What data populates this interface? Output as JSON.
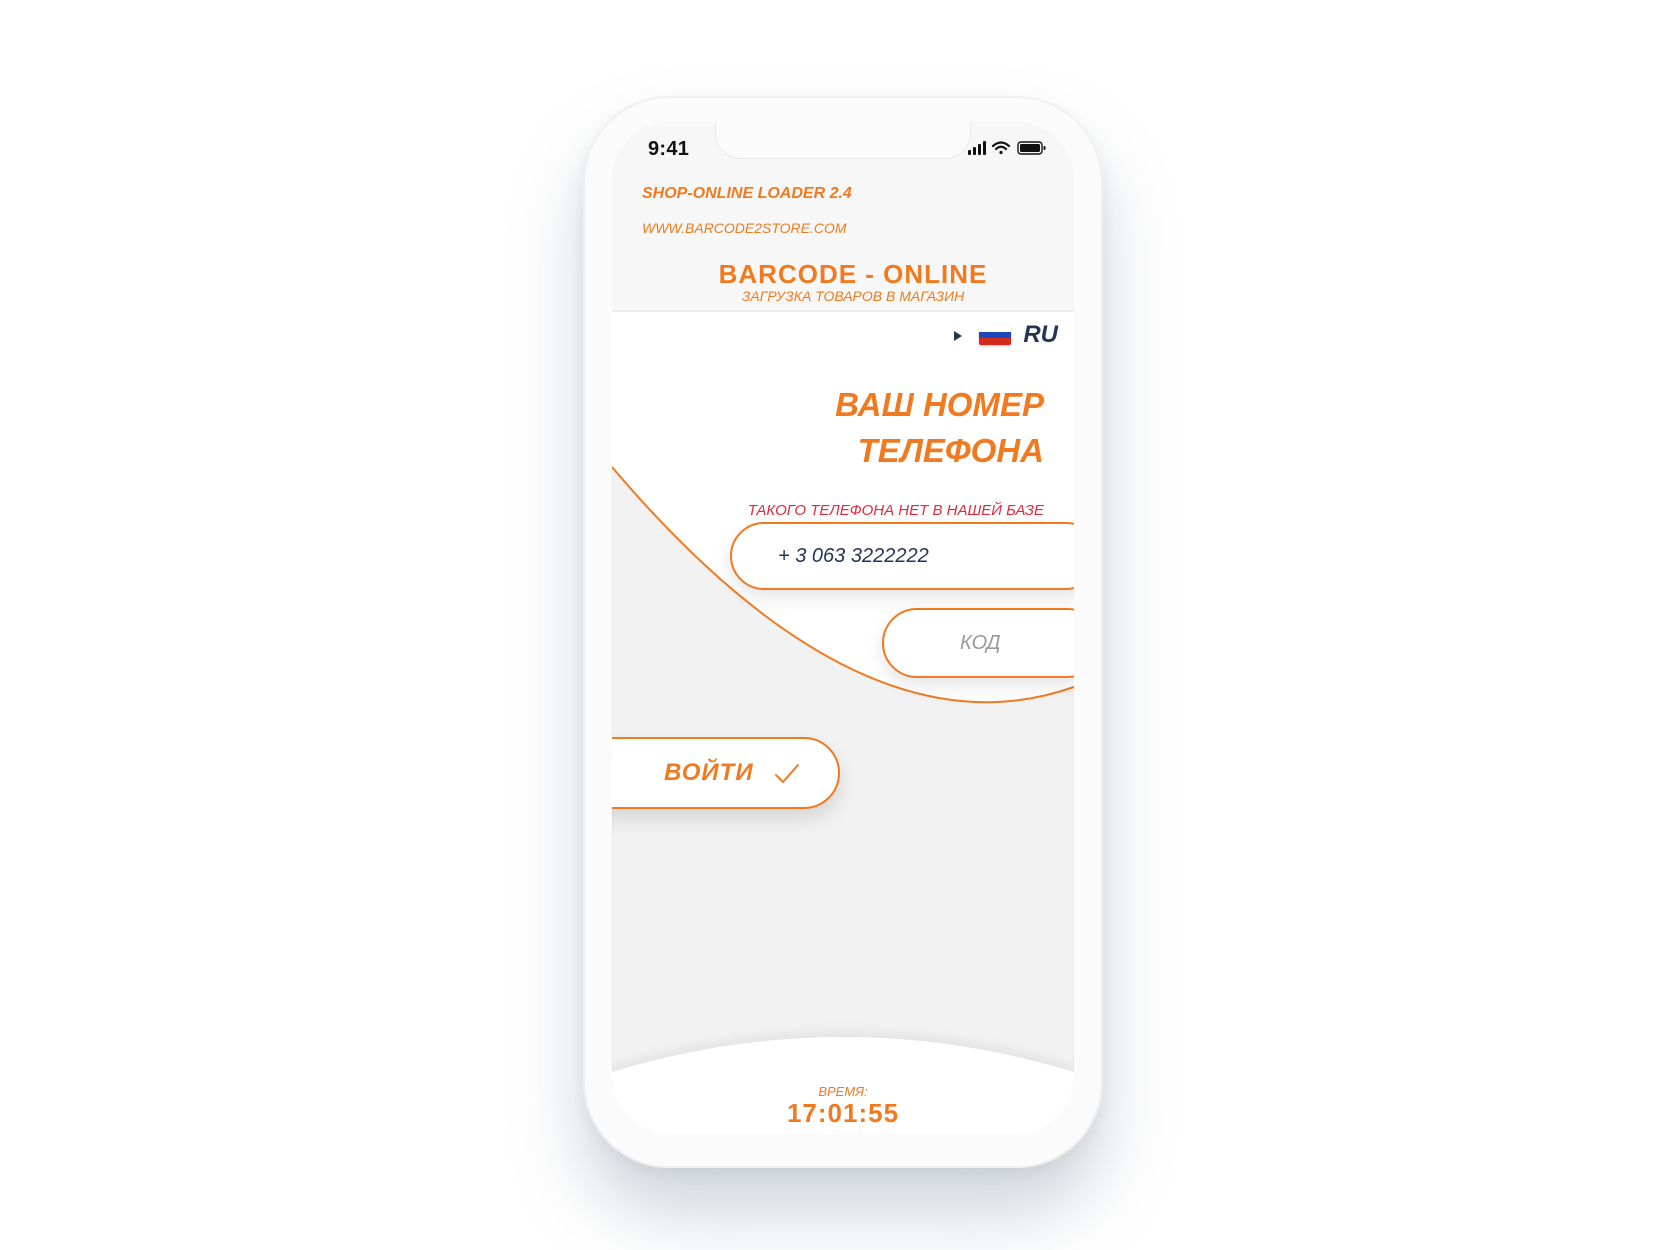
{
  "status_bar": {
    "time": "9:41"
  },
  "header": {
    "loader_title": "SHOP-ONLINE LOADER 2.4",
    "website": "WWW.BARCODE2STORE.COM",
    "brand": "BARCODE - ONLINE",
    "brand_subtitle": "ЗАГРУЗКА ТОВАРОВ В МАГАЗИН"
  },
  "language": {
    "code": "RU",
    "flag": "russia-flag-icon"
  },
  "form": {
    "heading_line1": "ВАШ НОМЕР",
    "heading_line2": "ТЕЛЕФОНА",
    "error_message": "ТАКОГО ТЕЛЕФОНА НЕТ В НАШЕЙ БАЗЕ",
    "phone_value": "+ 3 063 3222222",
    "code_placeholder": "КОД",
    "login_label": "ВОЙТИ"
  },
  "footer": {
    "time_label": "ВРЕМЯ:",
    "time_value": "17:01:55"
  },
  "colors": {
    "accent": "#f07a1f",
    "navy": "#253553",
    "error": "#e02a3e",
    "background": "#f2f2f2"
  }
}
